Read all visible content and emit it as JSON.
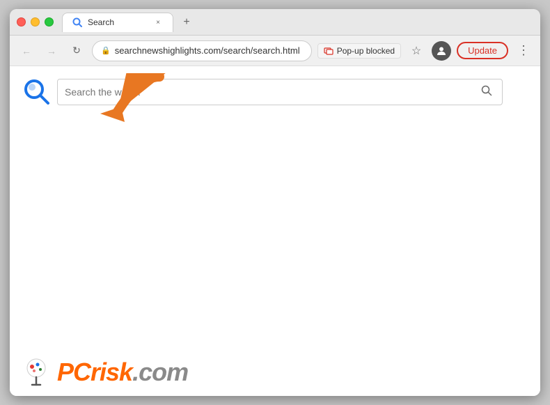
{
  "browser": {
    "tab": {
      "label": "Search",
      "close_label": "×"
    },
    "new_tab_label": "+",
    "nav": {
      "back_label": "←",
      "forward_label": "→",
      "reload_label": "↻",
      "address": "searchnewshighlights.com/search/search.html",
      "popup_blocked_label": "Pop-up blocked",
      "star_label": "☆",
      "menu_label": "⋮"
    },
    "update_button_label": "Update"
  },
  "page": {
    "search_placeholder": "Search the web...",
    "search_submit_label": "🔍"
  },
  "watermark": {
    "text_pc": "PC",
    "text_risk": "risk",
    "text_com": ".com"
  },
  "arrow": {
    "color": "#E87722"
  }
}
